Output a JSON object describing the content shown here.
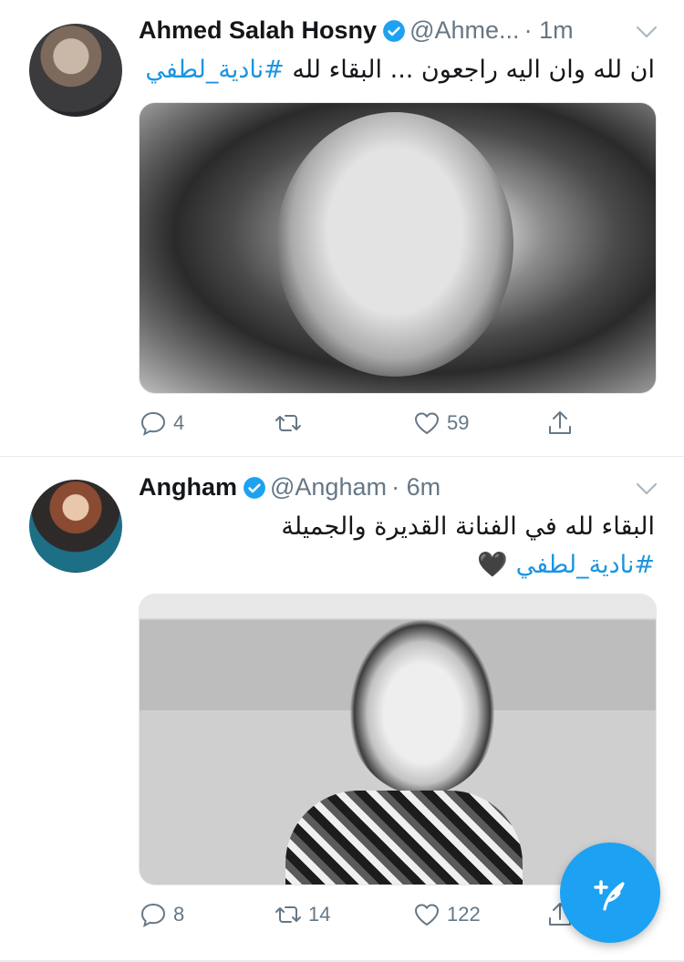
{
  "colors": {
    "accent": "#1b95e0",
    "fab": "#1da1f2",
    "muted": "#657786"
  },
  "tweets": [
    {
      "name": "Ahmed Salah Hosny",
      "handle": "@Ahme...",
      "time": "· 1m",
      "text": "ان لله وان اليه راجعون ... البقاء لله",
      "hashtag": "#نادية_لطفي",
      "replies": "4",
      "retweets": "",
      "likes": "59"
    },
    {
      "name": "Angham",
      "handle": "@Angham",
      "time": "· 6m",
      "text": "البقاء لله في الفنانة القديرة والجميلة",
      "hashtag": "#نادية_لطفي",
      "emoji": "🖤",
      "replies": "8",
      "retweets": "14",
      "likes": "122"
    }
  ],
  "icons": [
    "verified-badge-icon",
    "chevron-down-icon",
    "reply-icon",
    "retweet-icon",
    "like-icon",
    "share-icon",
    "compose-tweet-icon"
  ]
}
